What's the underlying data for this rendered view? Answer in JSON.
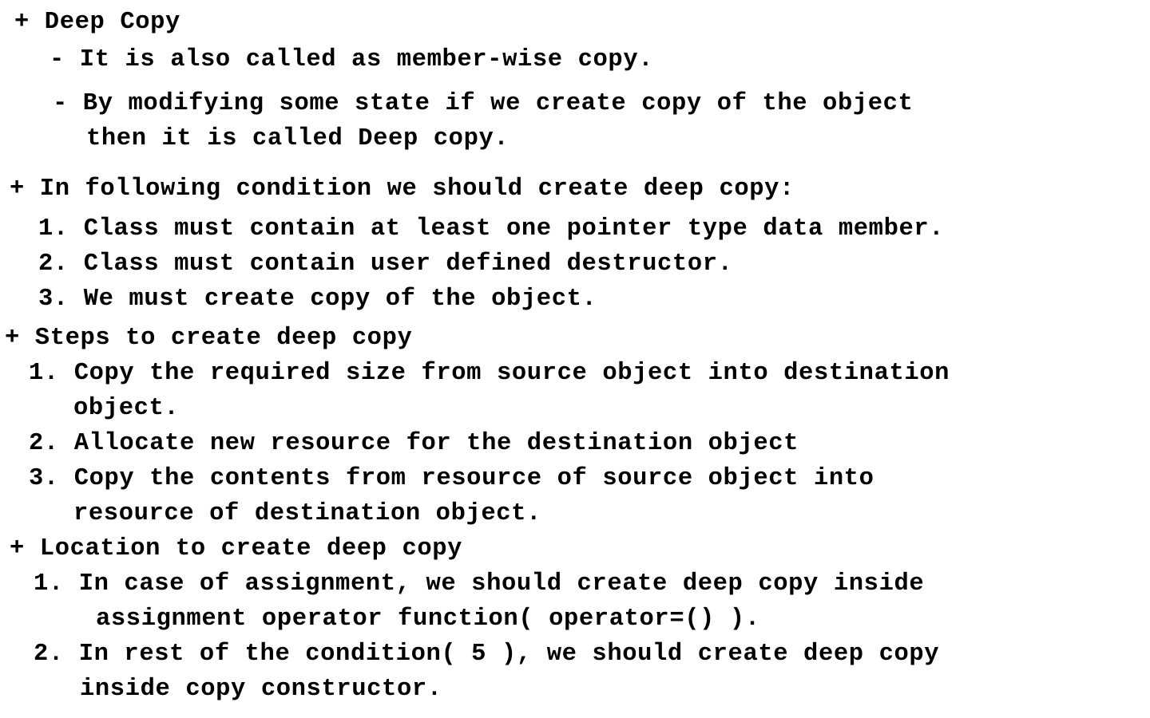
{
  "sections": [
    {
      "heading": "+ Deep Copy",
      "items": [
        {
          "lines": [
            "- It is also called as member-wise copy."
          ]
        },
        {
          "lines": [
            "- By modifying some state if we create copy of the object",
            "then it is called Deep copy."
          ]
        }
      ]
    },
    {
      "heading": "+ In following condition we should create deep copy:",
      "items": [
        {
          "lines": [
            "1. Class must contain at least one pointer type data member."
          ]
        },
        {
          "lines": [
            "2. Class must contain user defined destructor."
          ]
        },
        {
          "lines": [
            "3. We must create copy of the object."
          ]
        }
      ]
    },
    {
      "heading": "+ Steps to create deep copy",
      "items": [
        {
          "lines": [
            "1. Copy the required size from source object into destination",
            "object."
          ]
        },
        {
          "lines": [
            "2. Allocate new resource for the destination object"
          ]
        },
        {
          "lines": [
            "3. Copy the contents from resource of source object into",
            "resource of destination object."
          ]
        }
      ]
    },
    {
      "heading": "+ Location to create deep copy",
      "items": [
        {
          "lines": [
            "1. In case of assignment, we should create deep copy inside",
            "assignment operator function( operator=() )."
          ]
        },
        {
          "lines": [
            "2. In rest of the condition( 5 ), we should create deep copy",
            "inside copy constructor."
          ]
        }
      ]
    }
  ]
}
